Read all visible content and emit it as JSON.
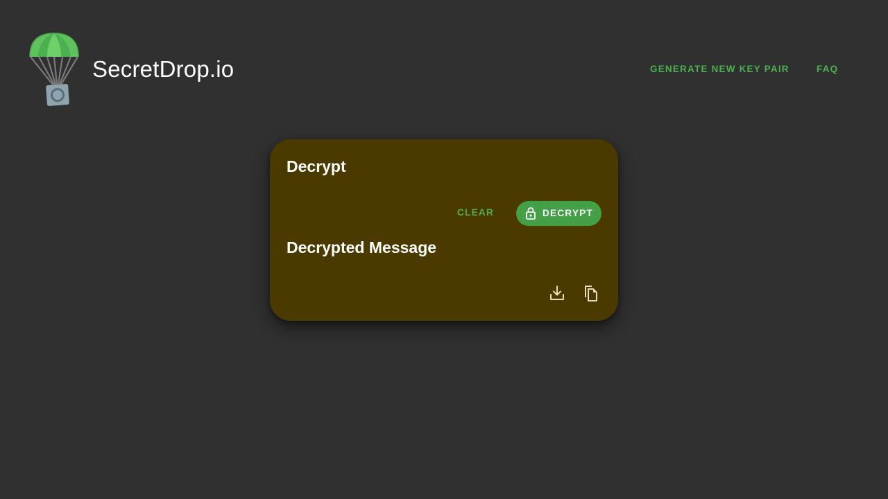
{
  "header": {
    "brand": "SecretDrop.io",
    "nav": {
      "generate_label": "GENERATE NEW KEY PAIR",
      "faq_label": "FAQ"
    }
  },
  "card": {
    "title": "Decrypt",
    "clear_label": "CLEAR",
    "decrypt_label": "DECRYPT",
    "output_title": "Decrypted Message",
    "icons": [
      "lock-icon",
      "download-icon",
      "copy-icon"
    ]
  },
  "colors": {
    "background": "#303030",
    "card": "#4b3a00",
    "accent": "#43a047",
    "accent_text": "#4caf50",
    "text": "#ffffff",
    "icon": "#e8dcc0"
  }
}
